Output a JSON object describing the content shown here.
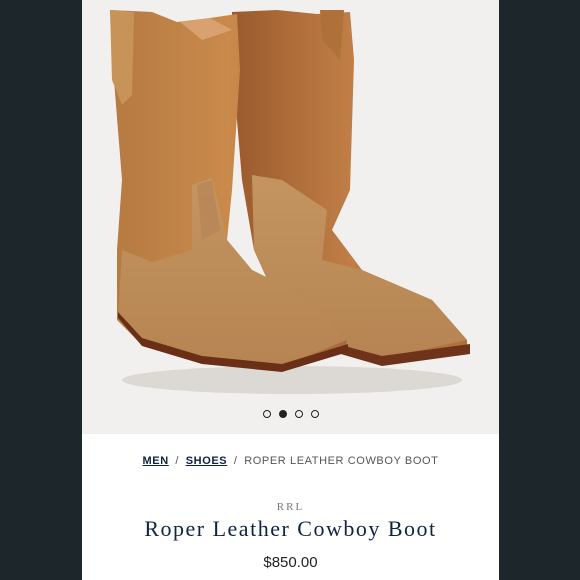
{
  "gallery": {
    "image_alt": "Pair of brown roper leather cowboy boots",
    "dots": [
      {
        "active": false
      },
      {
        "active": true
      },
      {
        "active": false
      },
      {
        "active": false
      }
    ]
  },
  "breadcrumb": {
    "men": "MEN",
    "shoes": "SHOES",
    "current": "ROPER LEATHER COWBOY BOOT",
    "separator": "/"
  },
  "product": {
    "brand": "RRL",
    "title": "Roper Leather Cowboy Boot",
    "price": "$850.00"
  },
  "colors": {
    "background": "#1c262b",
    "navy": "#0f2343"
  }
}
